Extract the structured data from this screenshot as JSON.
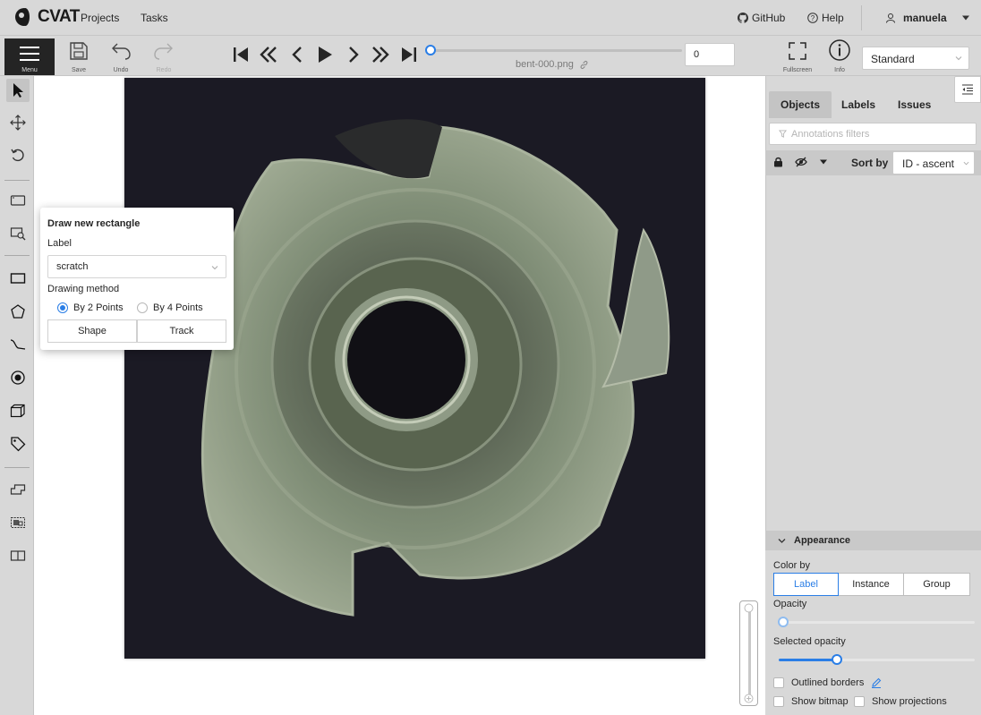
{
  "app": {
    "logo_text": "CVAT",
    "nav": {
      "projects": "Projects",
      "tasks": "Tasks"
    },
    "github": "GitHub",
    "help": "Help",
    "user": "manuela"
  },
  "toolbar": {
    "menu": "Menu",
    "save": "Save",
    "undo": "Undo",
    "redo": "Redo",
    "frame_name": "bent-000.png",
    "frame_number": "0",
    "fullscreen": "Fullscreen",
    "info": "Info",
    "workspace": "Standard"
  },
  "draw_popover": {
    "title": "Draw new rectangle",
    "label_heading": "Label",
    "label_value": "scratch",
    "method_heading": "Drawing method",
    "method_2": "By 2 Points",
    "method_4": "By 4 Points",
    "method_selected": "By 2 Points",
    "shape_button": "Shape",
    "track_button": "Track"
  },
  "right_panel": {
    "tabs": [
      {
        "label": "Objects",
        "active": true
      },
      {
        "label": "Labels",
        "active": false
      },
      {
        "label": "Issues",
        "active": false
      }
    ],
    "filter_placeholder": "Annotations filters",
    "sort_label": "Sort by",
    "sort_value": "ID - ascent",
    "appearance": {
      "title": "Appearance",
      "color_by_label": "Color by",
      "color_by_options": [
        "Label",
        "Instance",
        "Group"
      ],
      "color_by_selected": "Label",
      "opacity_label": "Opacity",
      "opacity_value": 0,
      "selected_opacity_label": "Selected opacity",
      "selected_opacity_value": 30,
      "outlined_borders": "Outlined borders",
      "show_bitmap": "Show bitmap",
      "show_projections": "Show projections"
    }
  },
  "colors": {
    "accent": "#2a7ee6",
    "toolbar_bg": "#d8d8d8",
    "image_bg": "#1b1a24"
  }
}
